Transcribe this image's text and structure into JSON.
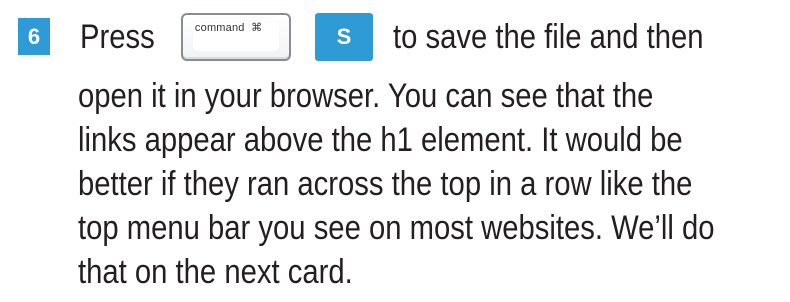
{
  "step": {
    "number": "6",
    "press_word": "Press",
    "command_key": {
      "label": "command",
      "symbol": "⌘"
    },
    "s_key": "S",
    "lines": [
      "to save the file and then",
      "open it in your browser. You can see that the",
      "links appear above the h1 element. It would be",
      "better if they ran across the top in a row like the",
      "top menu bar you see on most websites. We’ll do",
      "that on the next card."
    ]
  },
  "colors": {
    "accent": "#2e9bd6",
    "text": "#231f20"
  }
}
